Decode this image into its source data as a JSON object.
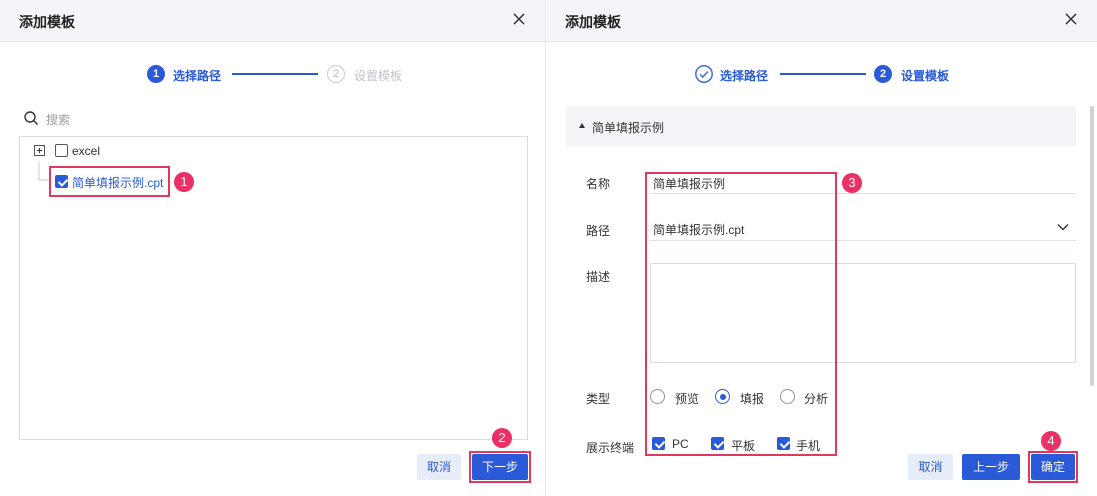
{
  "left_dialog": {
    "title": "添加模板",
    "steps": [
      {
        "number": "1",
        "label": "选择路径",
        "state": "active"
      },
      {
        "number": "2",
        "label": "设置模板",
        "state": "inactive"
      }
    ],
    "search": {
      "placeholder": "搜索"
    },
    "tree": [
      {
        "label": "excel",
        "expand_icon": "plus-square-icon",
        "checked": false
      },
      {
        "label": "简单填报示例.cpt",
        "checked": true,
        "selected": true
      }
    ],
    "buttons": {
      "cancel": "取消",
      "next": "下一步"
    }
  },
  "right_dialog": {
    "title": "添加模板",
    "steps": [
      {
        "number": "",
        "label": "选择路径",
        "state": "done",
        "icon": "check-circle-icon"
      },
      {
        "number": "2",
        "label": "设置模板",
        "state": "active"
      }
    ],
    "section_title": "简单填报示例",
    "form": {
      "name_label": "名称",
      "name_value": "简单填报示例",
      "path_label": "路径",
      "path_value": "简单填报示例.cpt",
      "desc_label": "描述",
      "desc_value": "",
      "type_label": "类型",
      "type_options": [
        "预览",
        "填报",
        "分析"
      ],
      "type_selected": "填报",
      "terminal_label": "展示终端",
      "terminal_options": [
        "PC",
        "平板",
        "手机"
      ],
      "terminal_checked": [
        "PC",
        "平板",
        "手机"
      ]
    },
    "buttons": {
      "cancel": "取消",
      "prev": "上一步",
      "confirm": "确定"
    }
  },
  "annotations": [
    "1",
    "2",
    "3",
    "4"
  ],
  "colors": {
    "primary": "#2a5ad7",
    "highlight": "#e0385f",
    "badge": "#ec2f64",
    "header_bg": "#f3f5f8"
  }
}
